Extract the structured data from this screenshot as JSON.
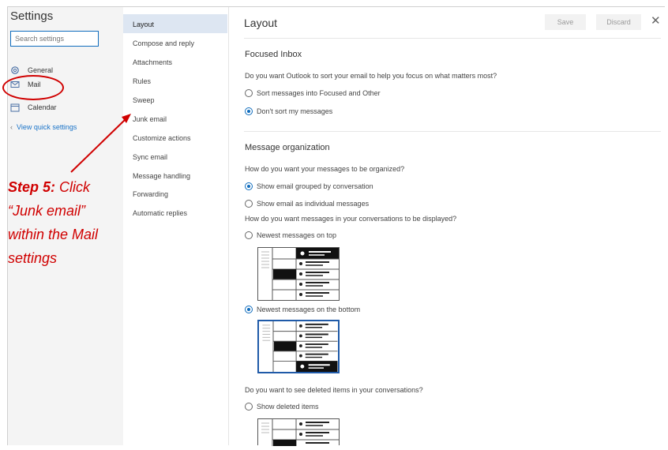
{
  "sidebar": {
    "title": "Settings",
    "search_placeholder": "Search settings",
    "items": [
      {
        "label": "General",
        "icon": "gear-icon"
      },
      {
        "label": "Mail",
        "icon": "mail-icon"
      },
      {
        "label": "Calendar",
        "icon": "calendar-icon"
      }
    ],
    "quick_settings": "View quick settings"
  },
  "mail_menu": {
    "items": [
      "Layout",
      "Compose and reply",
      "Attachments",
      "Rules",
      "Sweep",
      "Junk email",
      "Customize actions",
      "Sync email",
      "Message handling",
      "Forwarding",
      "Automatic replies"
    ],
    "selected": "Layout"
  },
  "header": {
    "title": "Layout",
    "save_label": "Save",
    "discard_label": "Discard",
    "close_icon": "close-icon"
  },
  "focused_inbox": {
    "title": "Focused Inbox",
    "question": "Do you want Outlook to sort your email to help you focus on what matters most?",
    "options": [
      "Sort messages into Focused and Other",
      "Don't sort my messages"
    ],
    "selected_index": 1
  },
  "message_organization": {
    "title": "Message organization",
    "question": "How do you want your messages to be organized?",
    "options": [
      "Show email grouped by conversation",
      "Show email as individual messages"
    ],
    "selected_index": 0,
    "display_question": "How do you want messages in your conversations to be displayed?",
    "display_options": [
      "Newest messages on top",
      "Newest messages on the bottom"
    ],
    "display_selected_index": 1,
    "deleted_question": "Do you want to see deleted items in your conversations?",
    "deleted_options": [
      "Show deleted items"
    ]
  },
  "annotation": {
    "step_label": "Step 5:",
    "step_line1_rest": " Click",
    "step_line2": "“Junk email”",
    "step_line3": "within the Mail",
    "step_line4": "settings",
    "color": "#d00000"
  },
  "colors": {
    "accent": "#0f6cbd",
    "selected_bg": "#dde6f2",
    "sidebar_bg": "#f4f4f4"
  }
}
